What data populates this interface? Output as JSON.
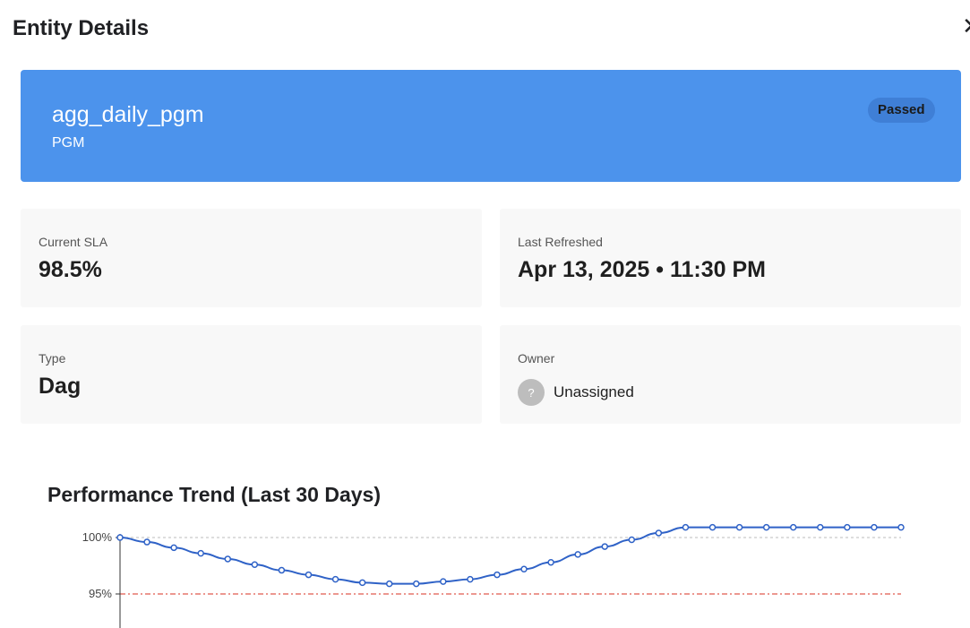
{
  "header": {
    "title": "Entity Details",
    "close_glyph": "✕"
  },
  "entity": {
    "name": "agg_daily_pgm",
    "subtitle": "PGM",
    "status": "Passed"
  },
  "colors": {
    "banner": "#4c93ec",
    "badge": "#3f7fd6",
    "line": "#2f62c7",
    "threshold": "#e05a4e",
    "avatar": "#bdbdbd"
  },
  "cards": {
    "sla": {
      "label": "Current SLA",
      "value": "98.5%"
    },
    "refreshed": {
      "label": "Last Refreshed",
      "value": "Apr 13, 2025 • 11:30 PM"
    },
    "type": {
      "label": "Type",
      "value": "Dag"
    },
    "owner": {
      "label": "Owner",
      "avatar_glyph": "?",
      "value": "Unassigned"
    }
  },
  "chart_title": "Performance Trend (Last 30 Days)",
  "chart_data": {
    "type": "line",
    "title": "Performance Trend (Last 30 Days)",
    "yticks": [
      {
        "value": 100,
        "label": "100%"
      },
      {
        "value": 95,
        "label": "95%"
      }
    ],
    "ylim": [
      92,
      101.5
    ],
    "threshold": 95,
    "reference": 100,
    "series": [
      {
        "values": [
          100,
          99.6,
          99.1,
          98.6,
          98.1,
          97.6,
          97.1,
          96.7,
          96.3,
          96.0,
          95.9,
          95.9,
          96.1,
          96.3,
          96.7,
          97.2,
          97.8,
          98.5,
          99.2,
          99.8,
          100.4,
          100.9,
          100.9,
          100.9,
          100.9,
          100.9,
          100.9,
          100.9,
          100.9,
          100.9
        ]
      }
    ]
  }
}
